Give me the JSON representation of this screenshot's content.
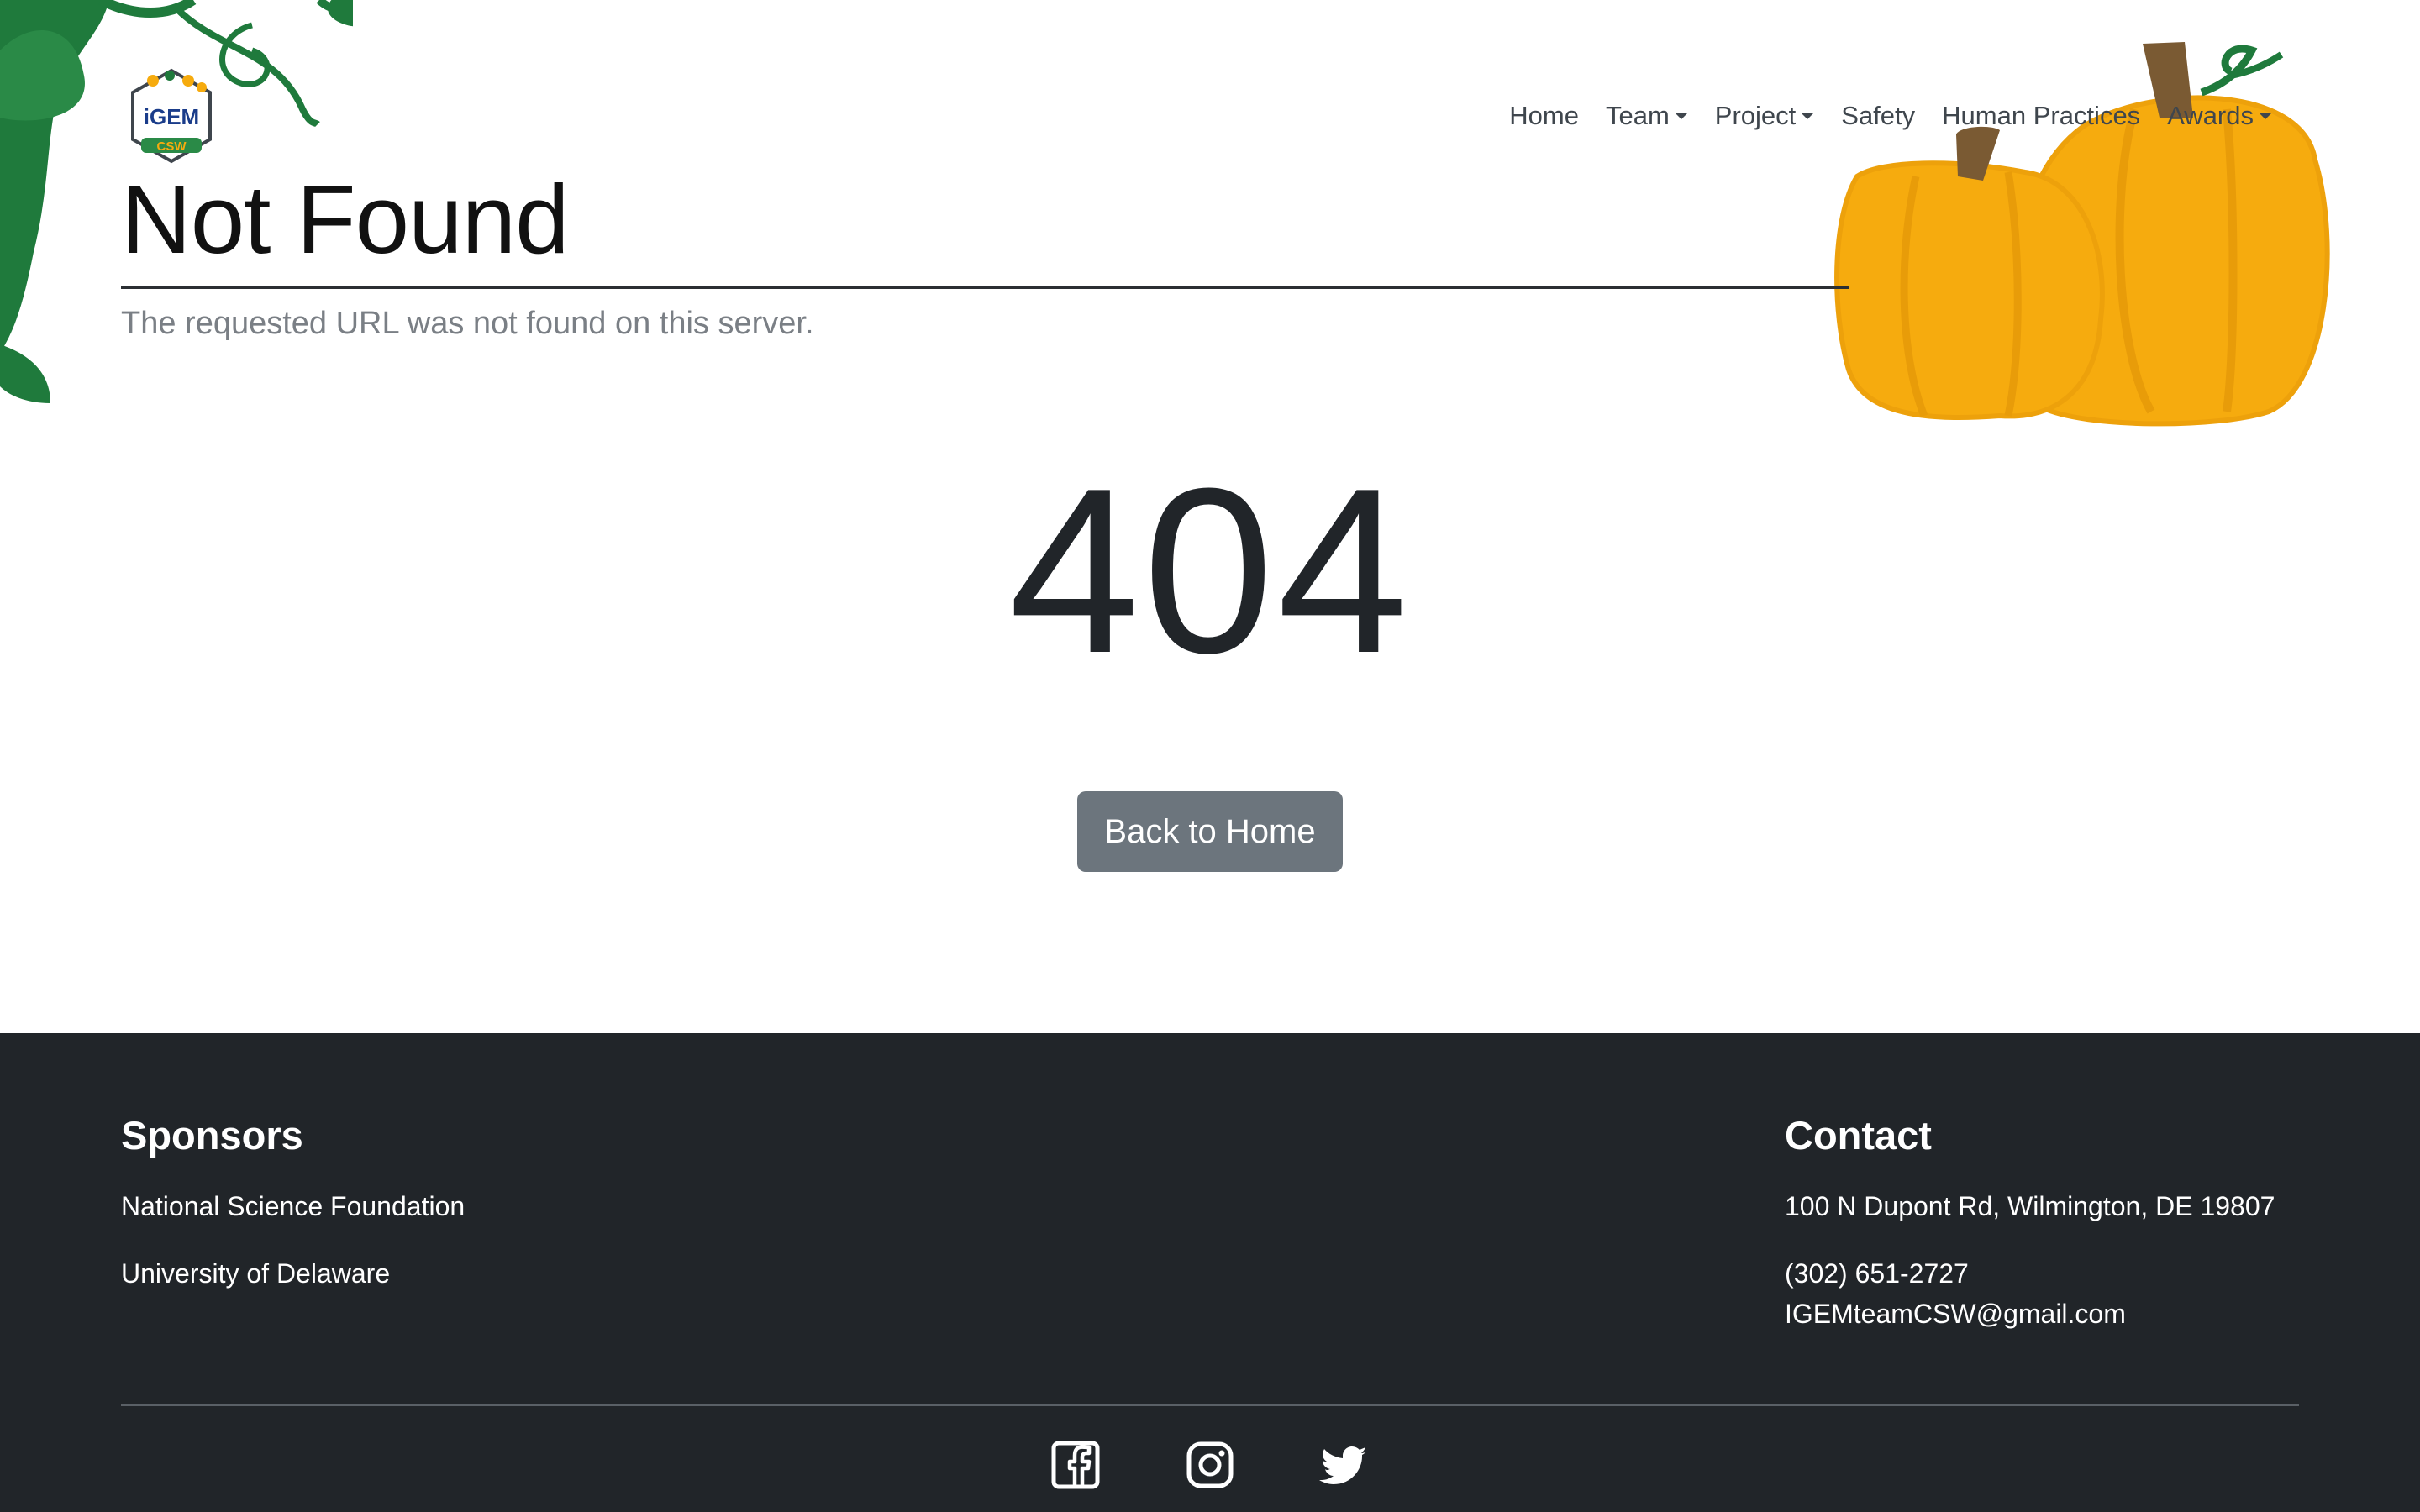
{
  "nav": {
    "items": [
      {
        "label": "Home",
        "dropdown": false
      },
      {
        "label": "Team",
        "dropdown": true
      },
      {
        "label": "Project",
        "dropdown": true
      },
      {
        "label": "Safety",
        "dropdown": false
      },
      {
        "label": "Human Practices",
        "dropdown": false
      },
      {
        "label": "Awards",
        "dropdown": true
      }
    ]
  },
  "logo": {
    "text": "iGEM",
    "badge": "CSW",
    "icon": "igem-logo"
  },
  "header": {
    "title": "Not Found",
    "subtitle": "The requested URL was not found on this server."
  },
  "error": {
    "code": "404"
  },
  "actions": {
    "back_label": "Back to Home"
  },
  "footer": {
    "sponsors": {
      "heading": "Sponsors",
      "items": [
        "National Science Foundation",
        "University of Delaware"
      ]
    },
    "contact": {
      "heading": "Contact",
      "address": "100 N Dupont Rd, Wilmington, DE 19807",
      "phone": "(302) 651-2727",
      "email": "IGEMteamCSW@gmail.com"
    },
    "socials": [
      "facebook-icon",
      "instagram-icon",
      "twitter-icon"
    ]
  },
  "colors": {
    "footer_bg": "#212529",
    "button_bg": "#6c757d",
    "vine_green": "#1f7a3c",
    "pumpkin_orange": "#f6ab0e",
    "stem_brown": "#7a5a33"
  }
}
